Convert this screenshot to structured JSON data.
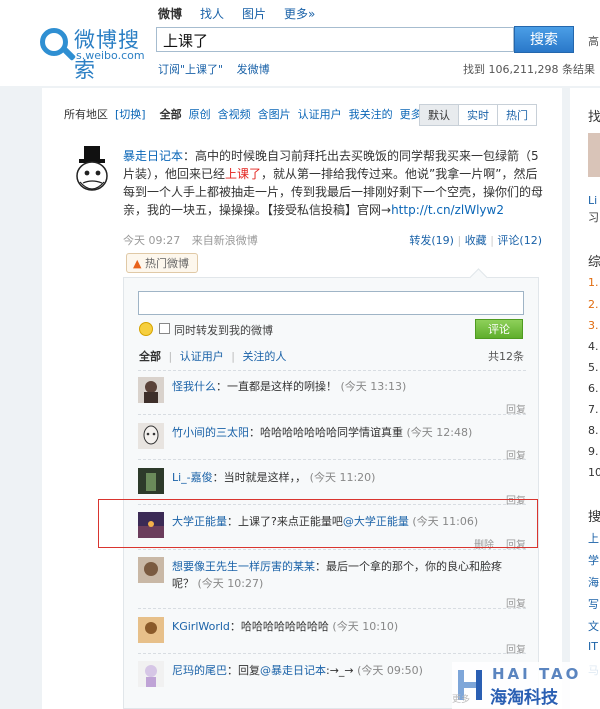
{
  "header": {
    "logo_title": "微博搜索",
    "logo_sub": "s.weibo.com",
    "tabs": [
      "微博",
      "找人",
      "图片",
      "更多»"
    ],
    "search_value": "上课了",
    "search_button": "搜索",
    "search_edge": "高",
    "subscribe_link": "订阅\"上课了\"",
    "post_link": "发微博",
    "result_count": "找到 106,211,298 条结果"
  },
  "filter": {
    "region": "所有地区",
    "switch": "[切换]",
    "items": [
      "全部",
      "原创",
      "含视频",
      "含图片",
      "认证用户",
      "我关注的",
      "更多»"
    ],
    "sort": [
      "默认",
      "实时",
      "热门"
    ]
  },
  "feed": {
    "author": "暴走日记本",
    "text_before": "：高中的时候晚自习前拜托出去买晚饭的同学帮我买来一包绿箭（5片装），他回来已经",
    "keyword": "上课了",
    "text_after": "，就从第一排给我传过来。他说”我拿一片啊”，然后每到一个人手上都被抽走一片，传到我最后一排刚好剩下一个空壳，操你们的母亲，我的一块五，操操操。【接受私信投稿】官网→",
    "url": "http://t.cn/zlWlyw2",
    "time": "今天 09:27",
    "source_prefix": "来自",
    "source": "新浪微博",
    "forward": "转发(19)",
    "favorite": "收藏",
    "comment": "评论(12)",
    "hot_tag": "热门微博"
  },
  "comments": {
    "forward_label": "同时转发到我的微博",
    "submit": "评论",
    "tabs": [
      "全部",
      "认证用户",
      "关注的人"
    ],
    "count": "共12条",
    "reply_label": "回复",
    "delete_label": "删除",
    "items": [
      {
        "user": "怪我什么",
        "text": "：一直都是这样的咧操！",
        "time": "(今天 13:13)"
      },
      {
        "user": "竹小间的三太阳",
        "text": "：哈哈哈哈哈哈哈同学情谊真重",
        "time": "(今天 12:48)"
      },
      {
        "user": "Li_-嘉俊",
        "text": "：当时就是这样，，",
        "time": "(今天 11:20)"
      },
      {
        "user": "大学正能量",
        "text": "：上课了?来点正能量吧",
        "mention": "@大学正能量",
        "time": "(今天 11:06)"
      },
      {
        "user": "想要像王先生一样厉害的某某",
        "text": "：最后一个拿的那个，你的良心和脸疼呢？",
        "time": "(今天 10:27)"
      },
      {
        "user": "KGirlWorld",
        "text": "：哈哈哈哈哈哈哈哈",
        "time": "(今天 10:10)"
      },
      {
        "user": "尼玛的尾巴",
        "text": "：回复",
        "mention": "@暴走日记本",
        "text2": ":→_→",
        "time": "(今天 09:50)"
      }
    ]
  },
  "right_panel": {
    "lines": [
      "找",
      "Li",
      "习",
      "综",
      "1.",
      "2.",
      "3.",
      "4.",
      "5.",
      "6.",
      "7.",
      "8.",
      "9.",
      "10",
      "搜",
      "上",
      "学",
      "海",
      "写",
      "文",
      "IT",
      "马"
    ]
  },
  "watermark": {
    "top": "HAI TAO",
    "bottom": "海淘科技",
    "footer_fragment": "更多"
  },
  "colors": {
    "link": "#1a62a8",
    "keyword_red": "#e3231e",
    "highlight_border": "#d9352f",
    "submit_green": "#5fae2c"
  }
}
